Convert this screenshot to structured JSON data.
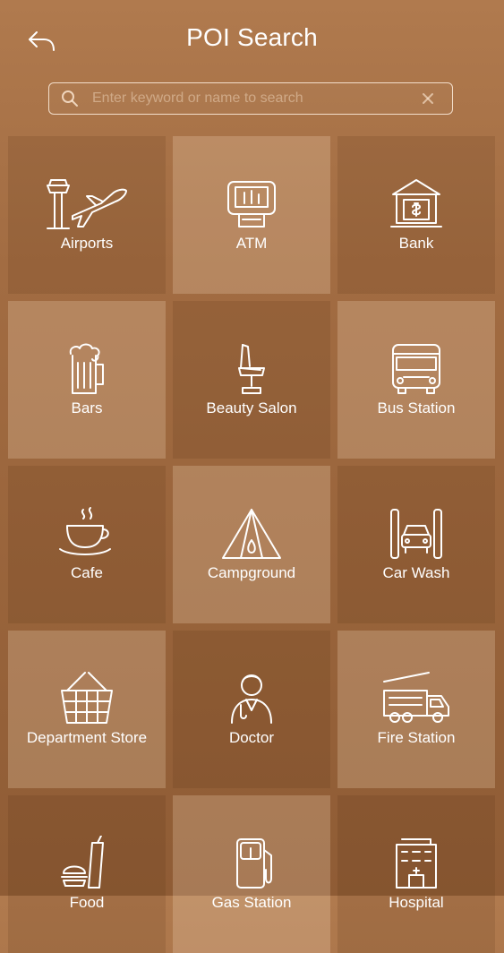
{
  "header": {
    "title": "POI Search",
    "back_icon": "back-arrow-icon"
  },
  "search": {
    "placeholder": "Enter keyword or name to search",
    "value": "",
    "search_icon": "search-icon",
    "clear_icon": "close-icon"
  },
  "colors": {
    "background_top": "#b07a4e",
    "background_bottom": "#8f5c35",
    "text": "#ffffff"
  },
  "categories": [
    {
      "label": "Airports",
      "icon": "airport-icon"
    },
    {
      "label": "ATM",
      "icon": "atm-icon"
    },
    {
      "label": "Bank",
      "icon": "bank-icon"
    },
    {
      "label": "Bars",
      "icon": "beer-mug-icon"
    },
    {
      "label": "Beauty Salon",
      "icon": "salon-chair-icon"
    },
    {
      "label": "Bus Station",
      "icon": "bus-icon"
    },
    {
      "label": "Cafe",
      "icon": "coffee-cup-icon"
    },
    {
      "label": "Campground",
      "icon": "tent-icon"
    },
    {
      "label": "Car Wash",
      "icon": "car-wash-icon"
    },
    {
      "label": "Department Store",
      "icon": "shopping-basket-icon"
    },
    {
      "label": "Doctor",
      "icon": "doctor-icon"
    },
    {
      "label": "Fire Station",
      "icon": "fire-truck-icon"
    },
    {
      "label": "Food",
      "icon": "fast-food-icon"
    },
    {
      "label": "Gas Station",
      "icon": "gas-pump-icon"
    },
    {
      "label": "Hospital",
      "icon": "hospital-icon"
    }
  ]
}
